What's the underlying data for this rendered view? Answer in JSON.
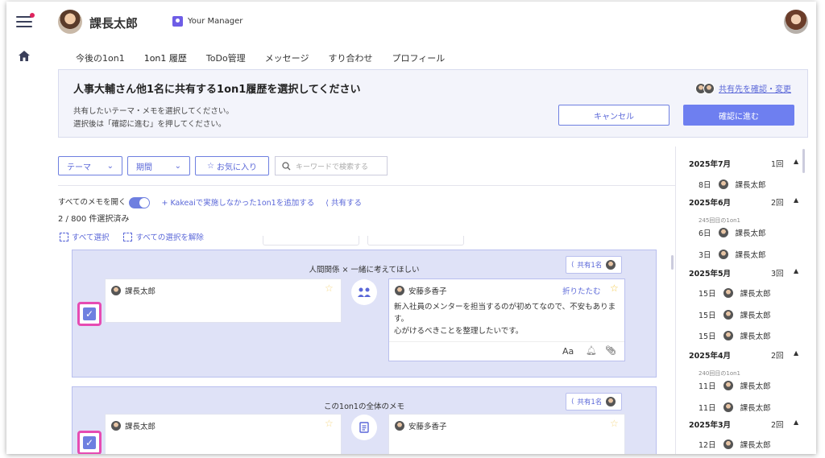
{
  "header": {
    "user_name": "課長太郎",
    "manager_label": "Your Manager"
  },
  "tabs": [
    "今後の1on1",
    "1on1 履歴",
    "ToDo管理",
    "メッセージ",
    "すり合わせ",
    "プロフィール"
  ],
  "banner": {
    "title": "人事大輔さん他1名に共有する1on1履歴を選択してください",
    "desc1": "共有したいテーマ・メモを選択してください。",
    "desc2": "選択後は「確認に進む」を押してください。",
    "share_link": "共有先を確認・変更",
    "cancel": "キャンセル",
    "confirm": "確認に進む"
  },
  "filters": {
    "theme": "テーマ",
    "period": "期間",
    "favorite": "お気に入り",
    "search_placeholder": "キーワードで検索する"
  },
  "actions": {
    "open_all": "すべてのメモを開く",
    "add": "+ Kakeaiで実施しなかった1on1を追加する",
    "share": "共有する",
    "count": "2 / 800 件選択済み",
    "select_all": "すべて選択",
    "deselect_all": "すべての選択を解除"
  },
  "cards": [
    {
      "title": "人間関係 × 一緒に考えてほしい",
      "share_label": "共有1名",
      "left_name": "課長太郎",
      "right_name": "安藤多香子",
      "fold": "折りたたむ",
      "text1": "新入社員のメンターを担当するのが初めてなので、不安もありま",
      "text2": "す。",
      "text3": "心がけるべきことを整理したいです。",
      "font": "Aa"
    },
    {
      "title": "この1on1の全体のメモ",
      "share_label": "共有1名",
      "left_name": "課長太郎",
      "right_name": "安藤多香子"
    }
  ],
  "history": [
    {
      "month": "2025年7月",
      "count": "1回",
      "entries": [
        {
          "sub": "",
          "day": "8日",
          "name": "課長太郎"
        }
      ]
    },
    {
      "month": "2025年6月",
      "count": "2回",
      "entries": [
        {
          "sub": "245回目の1on1",
          "day": "6日",
          "name": "課長太郎"
        },
        {
          "sub": "",
          "day": "3日",
          "name": "課長太郎"
        }
      ]
    },
    {
      "month": "2025年5月",
      "count": "3回",
      "entries": [
        {
          "sub": "",
          "day": "15日",
          "name": "課長太郎"
        },
        {
          "sub": "",
          "day": "15日",
          "name": "課長太郎"
        },
        {
          "sub": "",
          "day": "15日",
          "name": "課長太郎"
        }
      ]
    },
    {
      "month": "2025年4月",
      "count": "2回",
      "entries": [
        {
          "sub": "240回目の1on1",
          "day": "11日",
          "name": "課長太郎"
        },
        {
          "sub": "",
          "day": "11日",
          "name": "課長太郎"
        }
      ]
    },
    {
      "month": "2025年3月",
      "count": "2回",
      "entries": [
        {
          "sub": "",
          "day": "12日",
          "name": "課長太郎"
        }
      ]
    }
  ]
}
